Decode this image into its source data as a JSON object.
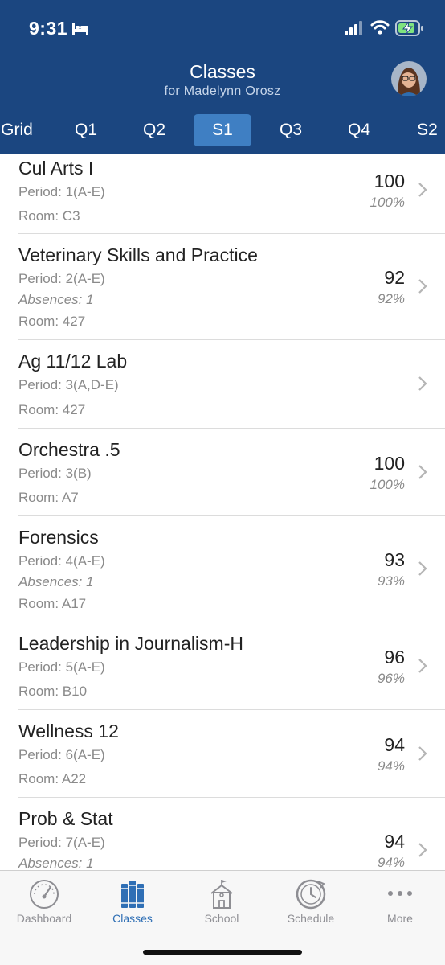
{
  "status_bar": {
    "time": "9:31"
  },
  "header": {
    "title": "Classes",
    "subtitle": "for Madelynn Orosz"
  },
  "tabs": [
    {
      "label": "Grid"
    },
    {
      "label": "Q1"
    },
    {
      "label": "Q2"
    },
    {
      "label": "S1",
      "active": true
    },
    {
      "label": "Q3"
    },
    {
      "label": "Q4"
    },
    {
      "label": "S2"
    }
  ],
  "classes": [
    {
      "name": "Cul Arts I",
      "period": "Period: 1(A-E)",
      "absences": "",
      "room": "Room: C3",
      "grade": "100",
      "percent": "100%"
    },
    {
      "name": "Veterinary Skills and Practice",
      "period": "Period: 2(A-E)",
      "absences": "Absences: 1",
      "room": "Room: 427",
      "grade": "92",
      "percent": "92%"
    },
    {
      "name": "Ag 11/12 Lab",
      "period": "Period: 3(A,D-E)",
      "absences": "",
      "room": "Room: 427",
      "grade": "",
      "percent": ""
    },
    {
      "name": "Orchestra .5",
      "period": "Period: 3(B)",
      "absences": "",
      "room": "Room: A7",
      "grade": "100",
      "percent": "100%"
    },
    {
      "name": "Forensics",
      "period": "Period: 4(A-E)",
      "absences": "Absences: 1",
      "room": "Room: A17",
      "grade": "93",
      "percent": "93%"
    },
    {
      "name": "Leadership in Journalism-H",
      "period": "Period: 5(A-E)",
      "absences": "",
      "room": "Room: B10",
      "grade": "96",
      "percent": "96%"
    },
    {
      "name": "Wellness 12",
      "period": "Period: 6(A-E)",
      "absences": "",
      "room": "Room: A22",
      "grade": "94",
      "percent": "94%"
    },
    {
      "name": "Prob & Stat",
      "period": "Period: 7(A-E)",
      "absences": "Absences: 1",
      "room": "",
      "grade": "94",
      "percent": "94%"
    }
  ],
  "tab_bar": [
    {
      "label": "Dashboard",
      "icon": "gauge-icon"
    },
    {
      "label": "Classes",
      "icon": "books-icon",
      "active": true
    },
    {
      "label": "School",
      "icon": "school-house-icon"
    },
    {
      "label": "Schedule",
      "icon": "clock-icon"
    },
    {
      "label": "More",
      "icon": "more-dots-icon"
    }
  ],
  "colors": {
    "header_bg": "#1b4680",
    "active_tab": "#3f7fc3",
    "tabbar_active": "#2f6fb5"
  }
}
